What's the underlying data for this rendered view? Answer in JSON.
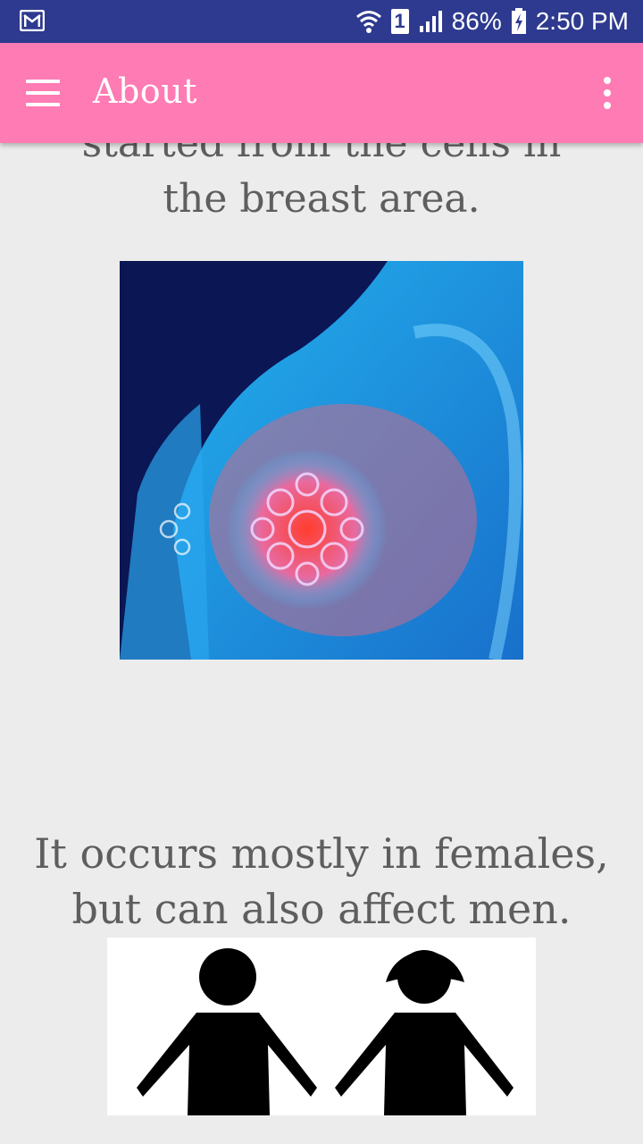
{
  "status_bar": {
    "battery": "86%",
    "time": "2:50 PM",
    "sim_badge": "1"
  },
  "app_bar": {
    "title": "About"
  },
  "content": {
    "paragraph1_line1": "started from the cells in",
    "paragraph1_line2": "the breast area.",
    "paragraph2_line1": "It occurs mostly in females,",
    "paragraph2_line2": "but can also affect men."
  },
  "colors": {
    "status_bar": "#2e3a8f",
    "app_bar": "#ff7bb3",
    "background": "#ececec",
    "text": "#5e5e5e"
  },
  "icons": {
    "status_left": "gmail-icon",
    "wifi": "wifi-icon",
    "signal": "signal-icon",
    "battery": "battery-charging-icon",
    "menu": "hamburger-menu-icon",
    "overflow": "more-vert-icon"
  }
}
